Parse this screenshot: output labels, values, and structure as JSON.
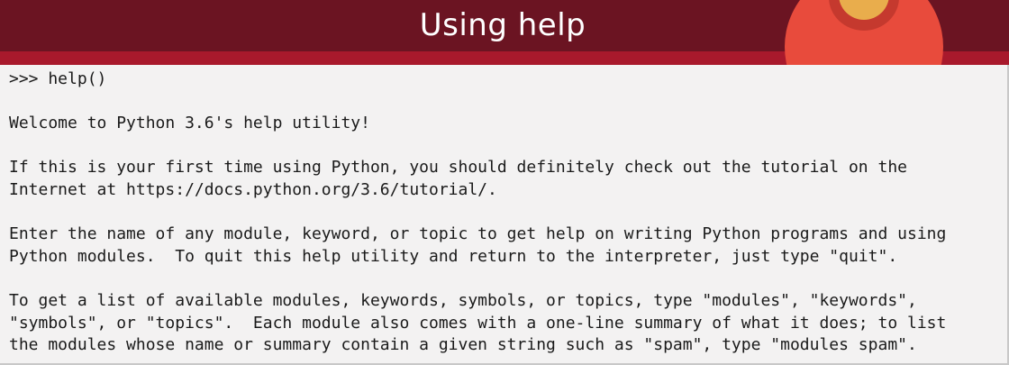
{
  "header": {
    "title": "Using help"
  },
  "console": {
    "lines": [
      ">>> help()",
      "",
      "Welcome to Python 3.6's help utility!",
      "",
      "If this is your first time using Python, you should definitely check out the tutorial on the",
      "Internet at https://docs.python.org/3.6/tutorial/.",
      "",
      "Enter the name of any module, keyword, or topic to get help on writing Python programs and using",
      "Python modules.  To quit this help utility and return to the interpreter, just type \"quit\".",
      "",
      "To get a list of available modules, keywords, symbols, or topics, type \"modules\", \"keywords\",",
      "\"symbols\", or \"topics\".  Each module also comes with a one-line summary of what it does; to list",
      "the modules whose name or summary contain a given string such as \"spam\", type \"modules spam\"."
    ]
  },
  "colors": {
    "header_dark": "#6b1422",
    "header_band": "#a8192c",
    "avatar_body": "#e84b3c",
    "avatar_head": "#e9ad4c",
    "console_bg": "#f3f2f2"
  }
}
